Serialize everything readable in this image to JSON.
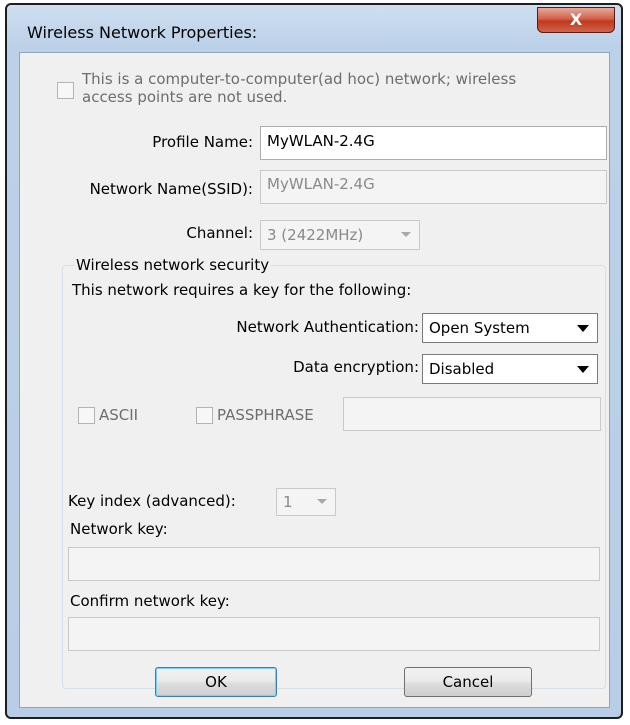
{
  "window": {
    "title": "Wireless Network Properties:",
    "close_glyph": "X"
  },
  "adhoc": {
    "label_line1": "This is a computer-to-computer(ad hoc) network; wireless",
    "label_line2": "access points are not used.",
    "checked": false
  },
  "profile": {
    "label": "Profile Name:",
    "value": "MyWLAN-2.4G"
  },
  "ssid": {
    "label": "Network Name(SSID):",
    "value": "MyWLAN-2.4G"
  },
  "channel": {
    "label": "Channel:",
    "value": "3 (2422MHz)"
  },
  "security": {
    "group_title": "Wireless network security",
    "requires_text": "This network requires a key for the following:",
    "auth_label": "Network Authentication:",
    "auth_value": "Open System",
    "encryption_label": "Data encryption:",
    "encryption_value": "Disabled",
    "ascii_label": "ASCII",
    "passphrase_label": "PASSPHRASE",
    "passphrase_value": "",
    "key_index_label": "Key index (advanced):",
    "key_index_value": "1",
    "network_key_label": "Network key:",
    "network_key_value": "",
    "confirm_key_label": "Confirm network key:",
    "confirm_key_value": ""
  },
  "buttons": {
    "ok": "OK",
    "cancel": "Cancel"
  },
  "colors": {
    "titlebar": "#bcd1e8",
    "close_button": "#c1381c",
    "client_bg": "#f0f0f0",
    "ok_focus": "#3c7fb1"
  },
  "icons": {
    "close": "close-icon",
    "dropdown": "chevron-down-icon"
  }
}
